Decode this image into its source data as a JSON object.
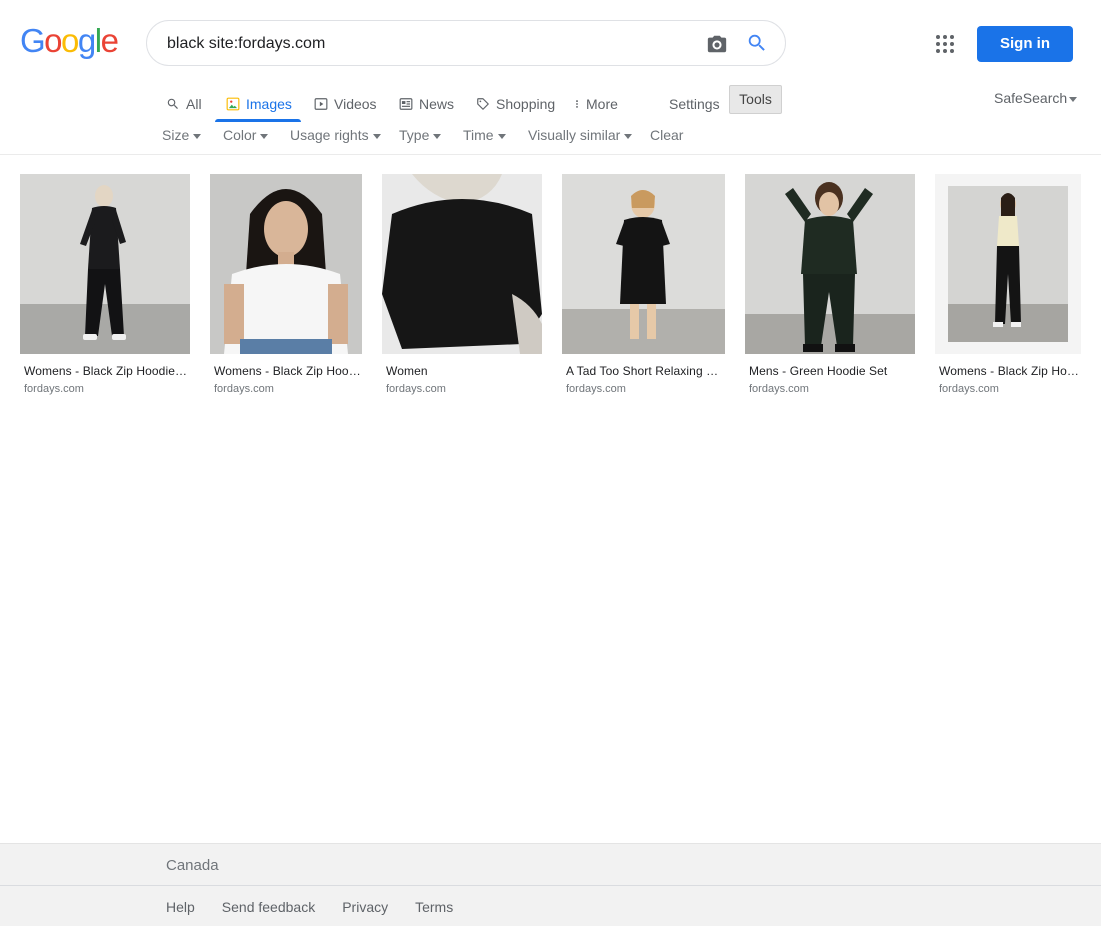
{
  "header": {
    "logo_letters": [
      "G",
      "o",
      "o",
      "g",
      "l",
      "e"
    ],
    "logo_colors": [
      "#4285F4",
      "#EA4335",
      "#FBBC05",
      "#4285F4",
      "#34A853",
      "#EA4335"
    ],
    "search_query": "black site:fordays.com",
    "camera_icon": "camera-icon",
    "search_icon": "search-icon",
    "apps_icon": "apps-grid-icon",
    "sign_in_label": "Sign in",
    "accent_color": "#1a73e8"
  },
  "tabs": [
    {
      "label": "All",
      "icon": "search-icon",
      "active": false
    },
    {
      "label": "Images",
      "icon": "image-icon",
      "active": true
    },
    {
      "label": "Videos",
      "icon": "play-icon",
      "active": false
    },
    {
      "label": "News",
      "icon": "newspaper-icon",
      "active": false
    },
    {
      "label": "Shopping",
      "icon": "tag-icon",
      "active": false
    },
    {
      "label": "More",
      "icon": "more-vert-icon",
      "active": false
    },
    {
      "label": "Settings",
      "active": false
    },
    {
      "label": "Tools",
      "active": false
    }
  ],
  "safesearch_label": "SafeSearch",
  "filters": [
    {
      "label": "Size"
    },
    {
      "label": "Color"
    },
    {
      "label": "Usage rights"
    },
    {
      "label": "Type"
    },
    {
      "label": "Time"
    },
    {
      "label": "Visually similar"
    },
    {
      "label": "Clear"
    }
  ],
  "results": [
    {
      "title": "Womens - Black Zip Hoodie Set",
      "source": "fordays.com"
    },
    {
      "title": "Womens - Black Zip Hoodie Set",
      "source": "fordays.com"
    },
    {
      "title": "Women",
      "source": "fordays.com"
    },
    {
      "title": "A Tad Too Short Relaxing Dress",
      "source": "fordays.com"
    },
    {
      "title": "Mens - Green Hoodie Set",
      "source": "fordays.com"
    },
    {
      "title": "Womens - Black Zip Hoodie Set",
      "source": "fordays.com"
    }
  ],
  "footer": {
    "country": "Canada",
    "links": [
      "Help",
      "Send feedback",
      "Privacy",
      "Terms"
    ]
  }
}
